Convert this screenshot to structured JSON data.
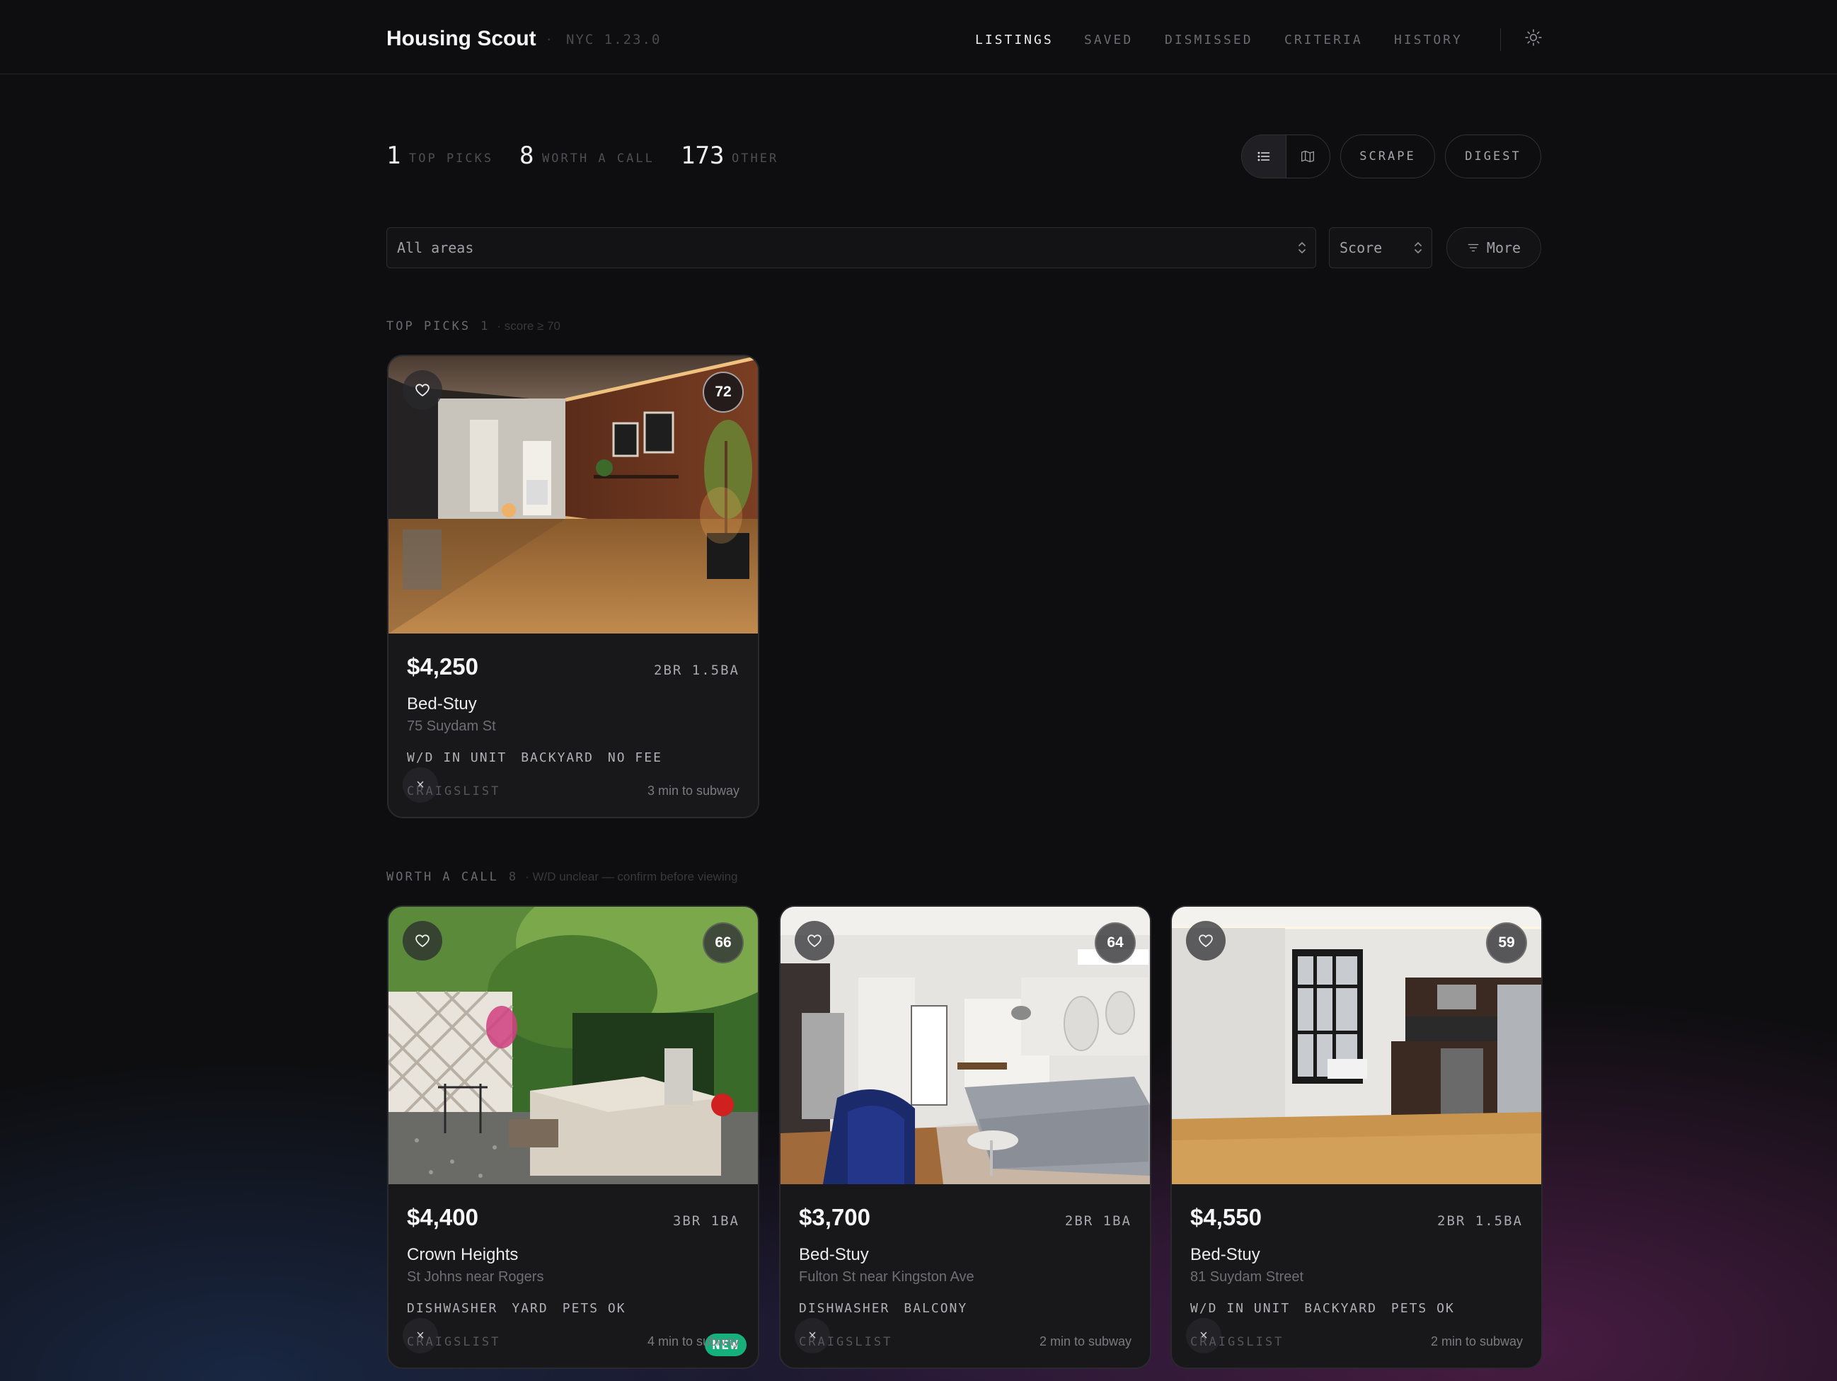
{
  "app": {
    "title": "Housing Scout",
    "separator": "·",
    "meta": "NYC  1.23.0"
  },
  "nav": {
    "items": [
      "LISTINGS",
      "SAVED",
      "DISMISSED",
      "CRITERIA",
      "HISTORY"
    ],
    "active": "LISTINGS"
  },
  "stats": [
    {
      "count": "1",
      "label": "TOP PICKS"
    },
    {
      "count": "8",
      "label": "WORTH A CALL"
    },
    {
      "count": "173",
      "label": "OTHER"
    }
  ],
  "actions": {
    "scrape_label": "SCRAPE",
    "digest_label": "DIGEST"
  },
  "filters": {
    "area_value": "All areas",
    "sort_value": "Score",
    "more_label": "More"
  },
  "sections": {
    "top_picks": {
      "title": "TOP PICKS",
      "count": "1",
      "note": "· score ≥ 70"
    },
    "worth_a_call": {
      "title": "WORTH A CALL",
      "count": "8",
      "note": "· W/D unclear — confirm before viewing"
    }
  },
  "listings": [
    {
      "price": "$4,250",
      "beds": "2BR 1.5BA",
      "neighborhood": "Bed-Stuy",
      "address": "75 Suydam St",
      "tags": [
        "W/D IN UNIT",
        "BACKYARD",
        "NO FEE"
      ],
      "source": "CRAIGSLIST",
      "commute": "3 min to subway",
      "score": "72",
      "badge": ""
    },
    {
      "price": "$4,400",
      "beds": "3BR 1BA",
      "neighborhood": "Crown Heights",
      "address": "St Johns near Rogers",
      "tags": [
        "DISHWASHER",
        "YARD",
        "PETS OK"
      ],
      "source": "CRAIGSLIST",
      "commute": "4 min to subway",
      "score": "66",
      "badge": "NEW"
    },
    {
      "price": "$3,700",
      "beds": "2BR 1BA",
      "neighborhood": "Bed-Stuy",
      "address": "Fulton St near Kingston Ave",
      "tags": [
        "DISHWASHER",
        "BALCONY"
      ],
      "source": "CRAIGSLIST",
      "commute": "2 min to subway",
      "score": "64",
      "badge": ""
    },
    {
      "price": "$4,550",
      "beds": "2BR 1.5BA",
      "neighborhood": "Bed-Stuy",
      "address": "81 Suydam Street",
      "tags": [
        "W/D IN UNIT",
        "BACKYARD",
        "PETS OK"
      ],
      "source": "CRAIGSLIST",
      "commute": "2 min to subway",
      "score": "59",
      "badge": ""
    }
  ],
  "icons": [
    "sun-icon",
    "list-icon",
    "map-icon",
    "filter-icon",
    "heart-icon",
    "close-icon",
    "chevron-updown-icon"
  ],
  "colors": {
    "background": "#0e0e10",
    "card": "#18181b",
    "badge_new": "#16b07a"
  }
}
